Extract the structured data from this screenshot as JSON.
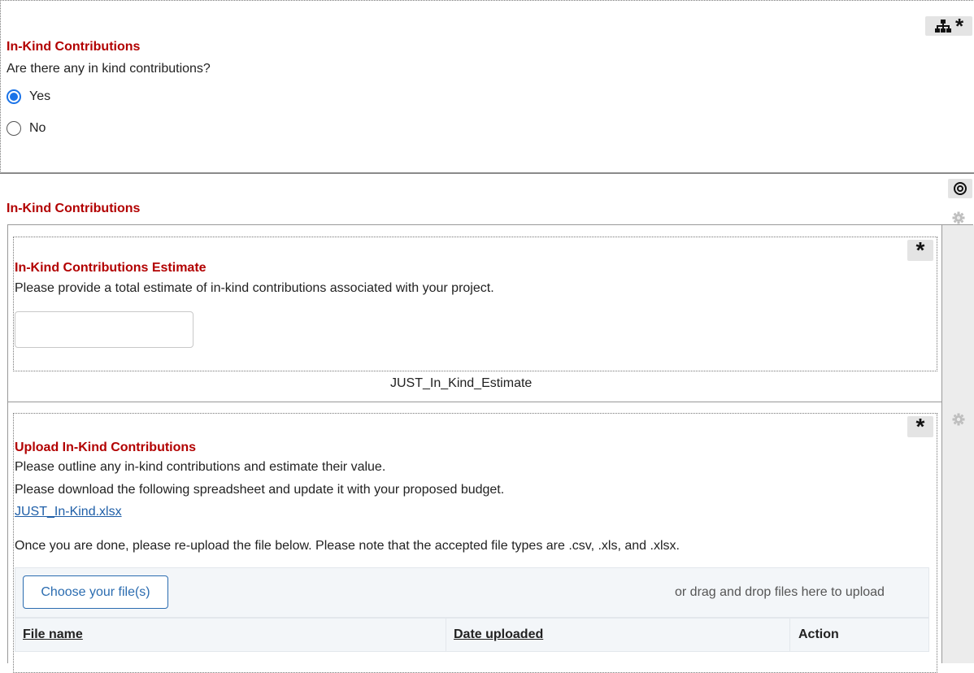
{
  "section1": {
    "title": "In-Kind Contributions",
    "question": "Are there any in kind contributions?",
    "options": [
      {
        "label": "Yes",
        "selected": true
      },
      {
        "label": "No",
        "selected": false
      }
    ],
    "tool_icons": [
      "hierarchy-icon",
      "asterisk-icon"
    ]
  },
  "section2": {
    "title": "In-Kind Contributions",
    "tool_icon": "target-icon",
    "estimate": {
      "title": "In-Kind Contributions Estimate",
      "description": "Please provide a total estimate of in-kind contributions associated with your project.",
      "input_value": "",
      "field_code": "JUST_In_Kind_Estimate",
      "required_icon": "asterisk-icon"
    },
    "upload": {
      "title": "Upload In-Kind Contributions",
      "line1": "Please outline any in-kind contributions and estimate their value.",
      "line2": "Please download the following spreadsheet and update it with your proposed budget.",
      "link_text": "JUST_In-Kind.xlsx",
      "line3": "Once you are done, please re-upload the file below. Please note that the accepted file types are .csv, .xls, and .xlsx.",
      "choose_button": "Choose your file(s)",
      "drop_hint": "or drag and drop files here to upload",
      "table_headers": [
        "File name",
        "Date uploaded",
        "Action"
      ],
      "required_icon": "asterisk-icon"
    },
    "side_icons": [
      "gear-icon",
      "gear-icon"
    ]
  }
}
